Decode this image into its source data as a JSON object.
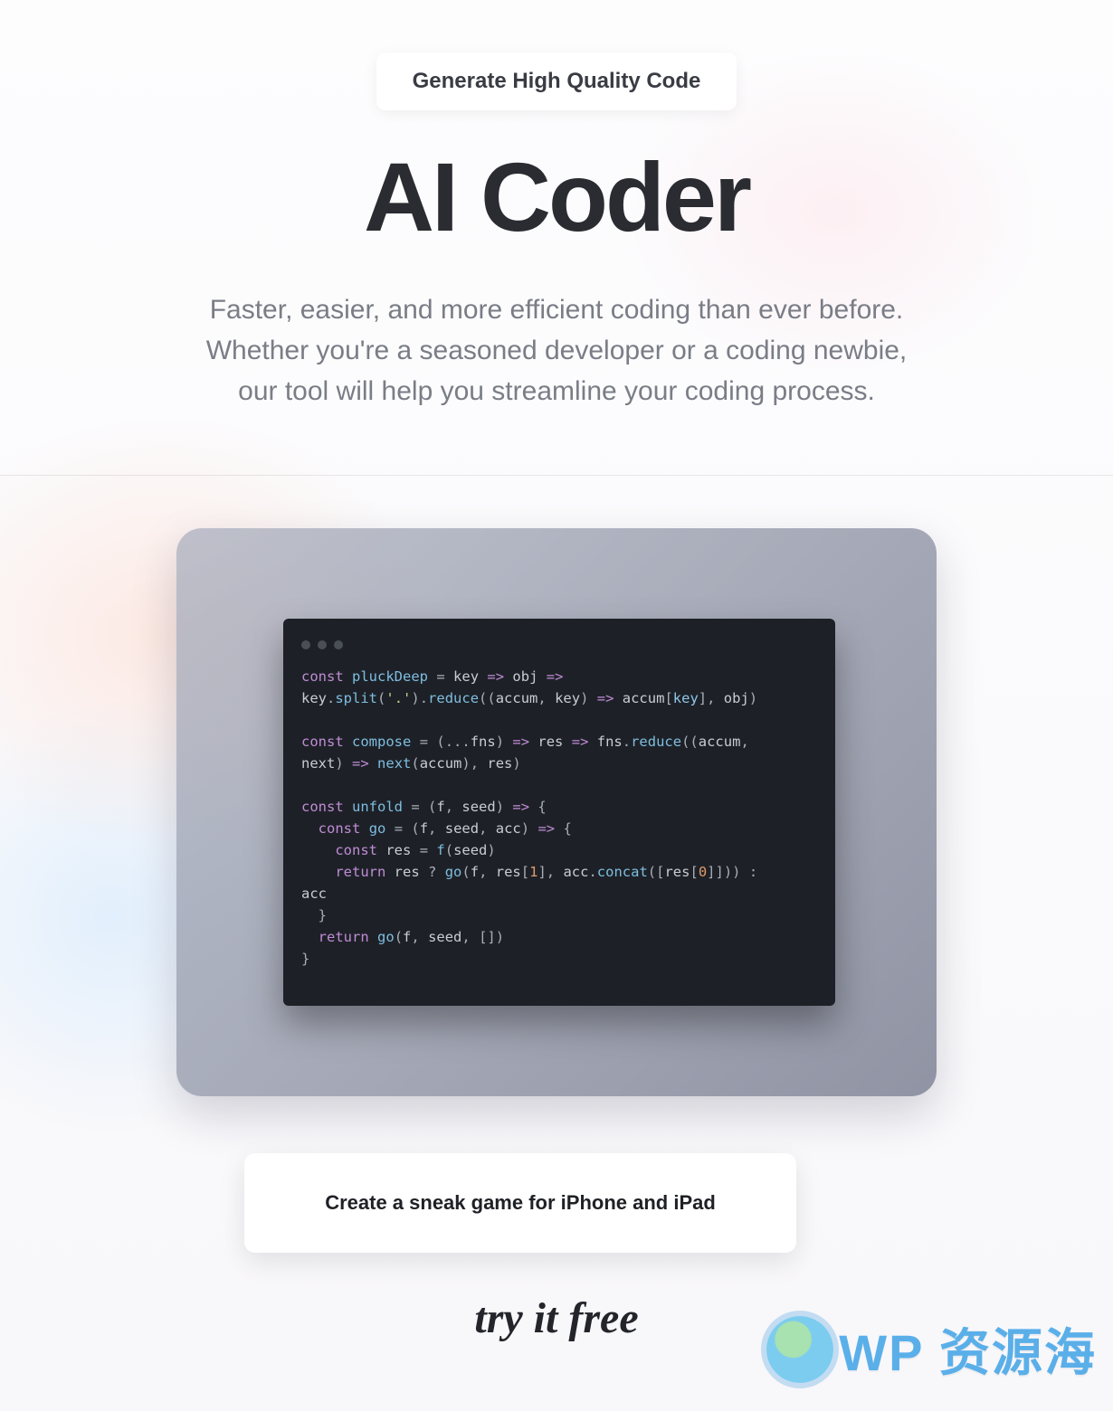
{
  "hero": {
    "pill": "Generate High Quality Code",
    "title": "AI Coder",
    "subtitle": "Faster, easier, and more efficient coding than ever before. Whether you're a seasoned developer or a coding newbie, our tool will help you streamline your coding process."
  },
  "editor": {
    "code_plain": "const pluckDeep = key => obj =>\nkey.split('.').reduce((accum, key) => accum[key], obj)\n\nconst compose = (...fns) => res => fns.reduce((accum,\nnext) => next(accum), res)\n\nconst unfold = (f, seed) => {\n  const go = (f, seed, acc) => {\n    const res = f(seed)\n    return res ? go(f, res[1], acc.concat([res[0]])) :\nacc\n  }\n  return go(f, seed, [])\n}"
  },
  "prompt_card": {
    "text": "Create a sneak game for iPhone and iPad"
  },
  "cta": {
    "try_free": "try it free"
  },
  "watermark": {
    "text": "WP 资源海"
  },
  "colors": {
    "ink": "#2a2c31",
    "muted": "#7a7d86",
    "panel_bg": "#8a8fa0",
    "editor_bg": "#1d2127",
    "accent_blue": "#4aa8e8"
  }
}
